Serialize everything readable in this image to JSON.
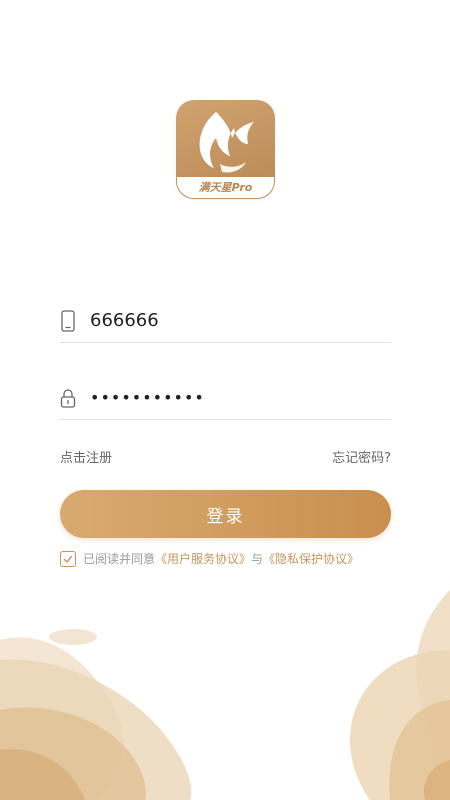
{
  "logo": {
    "text": "满天星Pro",
    "icon": "flame-fox-logo-icon",
    "brand_color": "#c39461"
  },
  "phone_field": {
    "icon": "phone-icon",
    "value": "666666",
    "placeholder": ""
  },
  "password_field": {
    "icon": "lock-icon",
    "value": "•••••••••••",
    "placeholder": ""
  },
  "links": {
    "register": "点击注册",
    "forgot_password": "忘记密码?"
  },
  "login_button": {
    "label": "登录"
  },
  "agreement": {
    "checked": true,
    "prefix": "已阅读并同意",
    "user_agreement": "《用户服务协议》",
    "joiner": "与",
    "privacy_agreement": "《隐私保护协议》"
  },
  "colors": {
    "accent": "#c9955a",
    "button_start": "#d9aa70",
    "button_end": "#c98f4e",
    "link_text": "#666666",
    "agreement_text": "#999999"
  }
}
